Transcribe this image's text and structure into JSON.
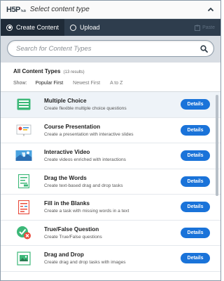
{
  "header": {
    "logo_main": "H5P",
    "logo_sub": "hub",
    "title": "Select content type"
  },
  "tabs": [
    {
      "label": "Create Content",
      "active": true
    },
    {
      "label": "Upload",
      "active": false
    }
  ],
  "paste_label": "Paste",
  "search": {
    "placeholder": "Search for Content Types"
  },
  "list_header": {
    "title": "All Content Types",
    "count": "(13 results)",
    "show_label": "Show:",
    "sort_options": [
      "Popular First",
      "Newest First",
      "A to Z"
    ],
    "active_sort": "Popular First"
  },
  "items": [
    {
      "title": "Multiple Choice",
      "desc": "Create flexible multiple choice questions",
      "button": "Details",
      "icon": "multiple-choice-icon"
    },
    {
      "title": "Course Presentation",
      "desc": "Create a presentation with interactive slides",
      "button": "Details",
      "icon": "course-presentation-icon"
    },
    {
      "title": "Interactive Video",
      "desc": "Create videos enriched with interactions",
      "button": "Details",
      "icon": "interactive-video-icon"
    },
    {
      "title": "Drag the Words",
      "desc": "Create text-based drag and drop tasks",
      "button": "Details",
      "icon": "drag-the-words-icon"
    },
    {
      "title": "Fill in the Blanks",
      "desc": "Create a task with missing words in a text",
      "button": "Details",
      "icon": "fill-in-the-blanks-icon"
    },
    {
      "title": "True/False Question",
      "desc": "Create True/False questions",
      "button": "Details",
      "icon": "true-false-icon"
    },
    {
      "title": "Drag and Drop",
      "desc": "Create drag and drop tasks with images",
      "button": "Details",
      "icon": "drag-and-drop-icon"
    }
  ],
  "colors": {
    "accent": "#1a73d9",
    "tabbar": "#2e3d4d",
    "search_bg": "#d8dde3"
  }
}
